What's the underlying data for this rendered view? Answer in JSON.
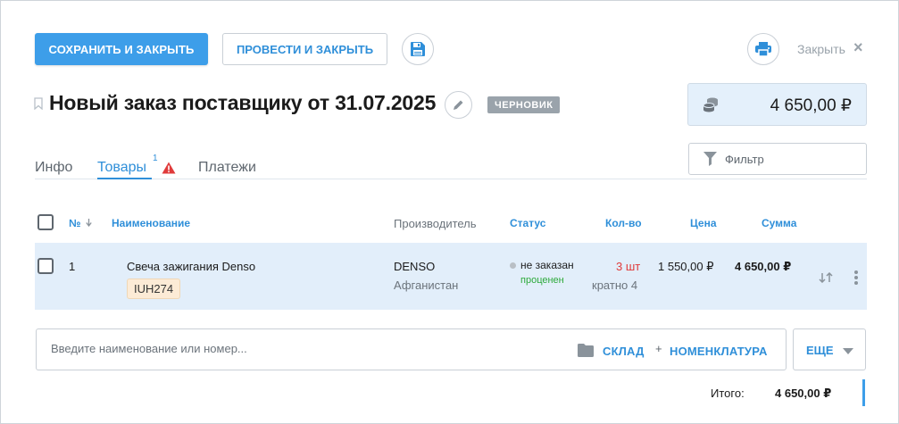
{
  "toolbar": {
    "save_close_label": "СОХРАНИТЬ И ЗАКРЫТЬ",
    "post_close_label": "ПРОВЕСТИ И ЗАКРЫТЬ",
    "save_icon": "floppy-disk-icon",
    "print_icon": "printer-icon",
    "close_label": "Закрыть",
    "close_icon": "×"
  },
  "header": {
    "title": "Новый заказ поставщику от 31.07.2025",
    "status": "ЧЕРНОВИК",
    "total": "4 650,00 ₽"
  },
  "tabs": [
    {
      "label": "Инфо"
    },
    {
      "label": "Товары",
      "badge": "1"
    },
    {
      "label": "Платежи"
    }
  ],
  "filter": {
    "label": "Фильтр"
  },
  "table": {
    "columns": {
      "num": "№",
      "name": "Наименование",
      "maker": "Производитель",
      "status": "Статус",
      "qty": "Кол-во",
      "price": "Цена",
      "sum": "Сумма"
    },
    "rows": [
      {
        "num": "1",
        "name": "Свеча зажигания Denso",
        "article": "IUH274",
        "maker": "DENSO",
        "country": "Афганистан",
        "status": "не заказан",
        "substatus": "процен­ен",
        "qty": "3 шт",
        "multiple": "кратно 4",
        "price": "1 550,00 ₽",
        "sum": "4 650,00 ₽"
      }
    ]
  },
  "add_row": {
    "placeholder": "Введите наименование или номер...",
    "warehouse_label": "СКЛАД",
    "plus": "+",
    "nomenclature_label": "НОМЕНКЛАТУРА",
    "more_label": "ЕЩЕ"
  },
  "summary": {
    "label": "Итого:",
    "value": "4 650,00 ₽"
  },
  "colors": {
    "accent": "#3d9ee9",
    "link": "#2f8fd9",
    "row_highlight": "#e2eefa",
    "warning": "#e03b3b",
    "success": "#2eaa3c"
  }
}
